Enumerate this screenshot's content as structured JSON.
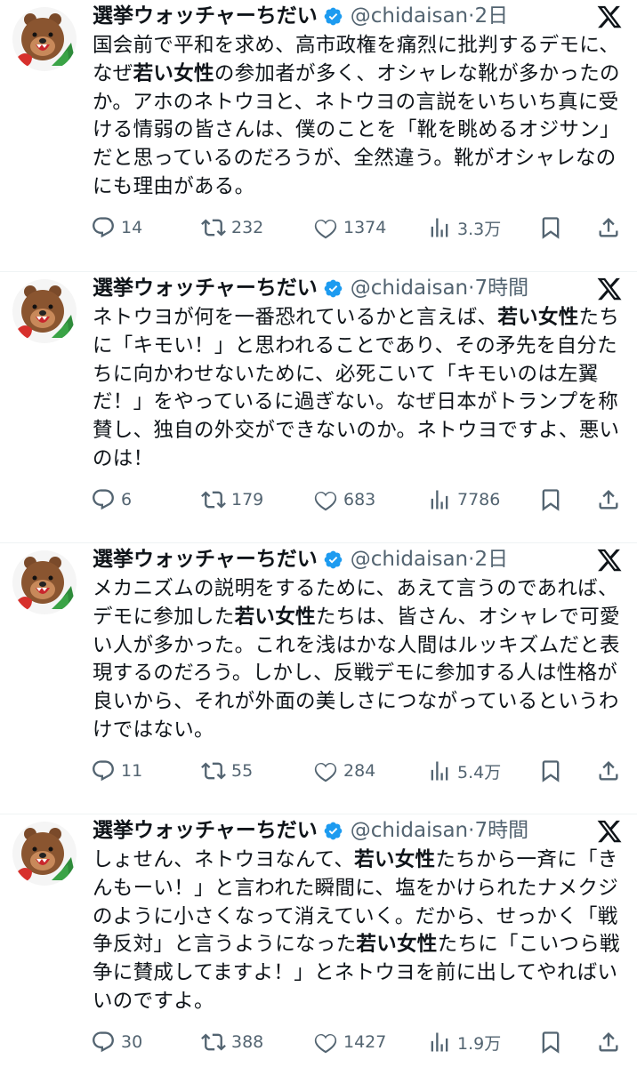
{
  "tweets": [
    {
      "name": "選挙ウォッチャーちだい",
      "handle": "@chidaisan",
      "separator": "·",
      "time": "2日",
      "body_parts": [
        {
          "text": "国会前で平和を求め、高市政権を痛烈に批判するデモに、なぜ",
          "bold": false
        },
        {
          "text": "若い女性",
          "bold": true
        },
        {
          "text": "の参加者が多く、オシャレな靴が多かったのか。アホのネトウヨと、ネトウヨの言説をいちいち真に受ける情弱の皆さんは、僕のことを「靴を眺めるオジサン」だと思っているのだろうが、全然違う。靴がオシャレなのにも理由がある。",
          "bold": false
        }
      ],
      "replies": "14",
      "retweets": "232",
      "likes": "1374",
      "views": "3.3万"
    },
    {
      "name": "選挙ウォッチャーちだい",
      "handle": "@chidaisan",
      "separator": "·",
      "time": "7時間",
      "body_parts": [
        {
          "text": "ネトウヨが何を一番恐れているかと言えば、",
          "bold": false
        },
        {
          "text": "若い女性",
          "bold": true
        },
        {
          "text": "たちに「キモい！」と思われることであり、その矛先を自分たちに向かわせないために、必死こいて「キモいのは左翼だ！」をやっているに過ぎない。なぜ日本がトランプを称賛し、独自の外交ができないのか。ネトウヨですよ、悪いのは！",
          "bold": false
        }
      ],
      "replies": "6",
      "retweets": "179",
      "likes": "683",
      "views": "7786"
    },
    {
      "name": "選挙ウォッチャーちだい",
      "handle": "@chidaisan",
      "separator": "·",
      "time": "2日",
      "body_parts": [
        {
          "text": "メカニズムの説明をするために、あえて言うのであれば、デモに参加した",
          "bold": false
        },
        {
          "text": "若い女性",
          "bold": true
        },
        {
          "text": "たちは、皆さん、オシャレで可愛い人が多かった。これを浅はかな人間はルッキズムだと表現するのだろう。しかし、反戦デモに参加する人は性格が良いから、それが外面の美しさにつながっているというわけではない。",
          "bold": false
        }
      ],
      "replies": "11",
      "retweets": "55",
      "likes": "284",
      "views": "5.4万"
    },
    {
      "name": "選挙ウォッチャーちだい",
      "handle": "@chidaisan",
      "separator": "·",
      "time": "7時間",
      "body_parts": [
        {
          "text": "しょせん、ネトウヨなんて、",
          "bold": false
        },
        {
          "text": "若い女性",
          "bold": true
        },
        {
          "text": "たちから一斉に「きんもーい！」と言われた瞬間に、塩をかけられたナメクジのように小さくなって消えていく。だから、せっかく「戦争反対」と言うようになった",
          "bold": false
        },
        {
          "text": "若い女性",
          "bold": true
        },
        {
          "text": "たちに「こいつら戦争に賛成してますよ！」とネトウヨを前に出してやればいいのですよ。",
          "bold": false
        }
      ],
      "replies": "30",
      "retweets": "388",
      "likes": "1427",
      "views": "1.9万"
    }
  ],
  "icons": {
    "avatar": "bear-avatar-icon",
    "verified": "verified-badge-icon",
    "platform": "x-logo-icon",
    "reply": "reply-icon",
    "retweet": "retweet-icon",
    "like": "heart-icon",
    "views": "views-icon",
    "bookmark": "bookmark-icon",
    "share": "share-icon"
  },
  "colors": {
    "text": "#0f1419",
    "muted": "#536471",
    "verified": "#1d9bf0",
    "divider": "#eff3f4"
  }
}
